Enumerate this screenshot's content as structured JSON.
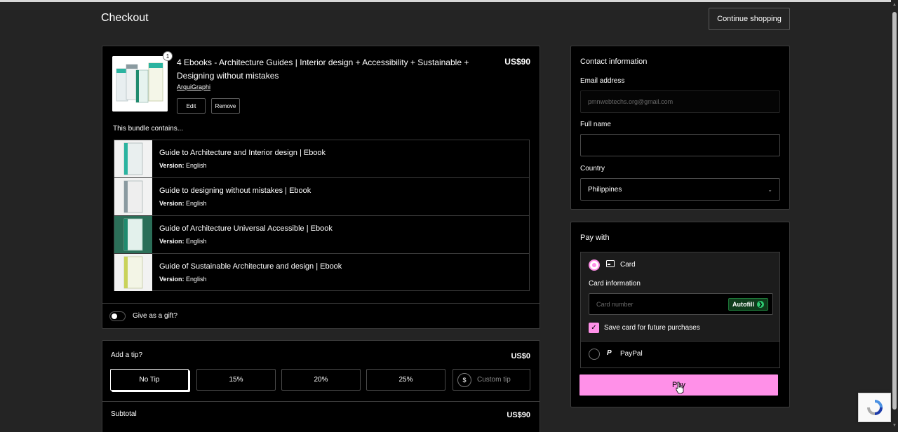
{
  "header": {
    "title": "Checkout",
    "continue_label": "Continue shopping"
  },
  "product": {
    "quantity": "1",
    "title": "4 Ebooks - Architecture Guides | Interior design + Accessibility + Sustainable + Designing without mistakes",
    "price": "US$90",
    "seller": "ArquiGraphi",
    "edit_label": "Edit",
    "remove_label": "Remove"
  },
  "bundle": {
    "label": "This bundle contains...",
    "items": [
      {
        "name": "Guide to Architecture and Interior design | Ebook",
        "version_label": "Version:",
        "version": "English",
        "accent": "#2bb3a0"
      },
      {
        "name": "Guide to designing without mistakes | Ebook",
        "version_label": "Version:",
        "version": "English",
        "accent": "#8a9aa0"
      },
      {
        "name": "Guide of Architecture Universal Accessible | Ebook",
        "version_label": "Version:",
        "version": "English",
        "accent": "#1f8a6e"
      },
      {
        "name": "Guide of Sustainable Architecture and design | Ebook",
        "version_label": "Version:",
        "version": "English",
        "accent": "#c9d25a"
      }
    ]
  },
  "gift": {
    "label": "Give as a gift?",
    "enabled": false
  },
  "tip": {
    "label": "Add a tip?",
    "amount": "US$0",
    "options": [
      "No Tip",
      "15%",
      "20%",
      "25%"
    ],
    "selected": "No Tip",
    "custom_symbol": "$",
    "custom_placeholder": "Custom tip"
  },
  "summary": {
    "subtotal_label": "Subtotal",
    "subtotal_value": "US$90"
  },
  "contact": {
    "heading": "Contact information",
    "email_label": "Email address",
    "email_placeholder": "pmnwebtechs.org@gmail.com",
    "name_label": "Full name",
    "name_value": "",
    "country_label": "Country",
    "country_value": "Philippines"
  },
  "payment": {
    "heading": "Pay with",
    "card_label": "Card",
    "card_info_label": "Card information",
    "card_placeholder": "Card number",
    "autofill_label": "Autofill",
    "save_card_label": "Save card for future purchases",
    "save_card_checked": true,
    "paypal_label": "PayPal",
    "selected_method": "Card",
    "pay_label": "Pay"
  },
  "colors": {
    "accent_pink": "#ff90e8",
    "background": "#242424",
    "panel": "#000000"
  },
  "icons": {
    "card": "card-icon",
    "paypal": "paypal-icon",
    "dropdown": "chevron-down-icon",
    "autofill": "arrow-right-circle-icon",
    "recaptcha": "recaptcha-icon"
  }
}
